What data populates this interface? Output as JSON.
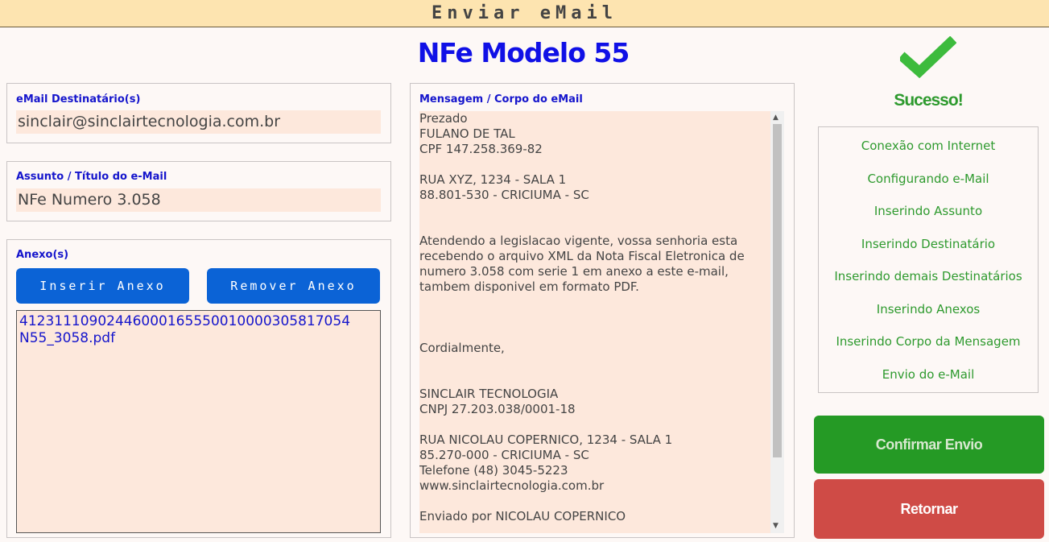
{
  "window": {
    "title": "Enviar eMail"
  },
  "heading": "NFe Modelo 55",
  "recipients": {
    "label": "eMail Destinatário(s)",
    "value": "sinclair@sinclairtecnologia.com.br"
  },
  "subject": {
    "label": "Assunto / Título do e-Mail",
    "value": "NFe Numero 3.058"
  },
  "attachments": {
    "label": "Anexo(s)",
    "insert_label": "Inserir Anexo",
    "remove_label": "Remover Anexo",
    "items": [
      "41231110902446000165550010000305817054",
      "N55_3058.pdf"
    ]
  },
  "message": {
    "label": "Mensagem / Corpo do eMail",
    "body": "Prezado\nFULANO DE TAL\nCPF 147.258.369-82\n\nRUA XYZ, 1234 - SALA 1\n88.801-530 - CRICIUMA - SC\n\n\nAtendendo a legislacao vigente, vossa senhoria esta recebendo o arquivo XML da Nota Fiscal Eletronica de numero 3.058 com serie 1 em anexo a este e-mail, tambem disponivel em formato PDF.\n\n\n\nCordialmente,\n\n\nSINCLAIR TECNOLOGIA\nCNPJ 27.203.038/0001-18\n\nRUA NICOLAU COPERNICO, 1234 - SALA 1\n85.270-000 - CRICIUMA - SC\nTelefone (48) 3045-5223\nwww.sinclairtecnologia.com.br\n\nEnviado por NICOLAU COPERNICO"
  },
  "status": {
    "icon": "checkmark-icon",
    "text": "Sucesso!",
    "color": "#2e9a2e"
  },
  "steps": [
    "Conexão com Internet",
    "Configurando e-Mail",
    "Inserindo Assunto",
    "Inserindo Destinatário",
    "Inserindo demais Destinatários",
    "Inserindo Anexos",
    "Inserindo Corpo da Mensagem",
    "Envio do e-Mail"
  ],
  "actions": {
    "confirm_label": "Confirmar Envio",
    "return_label": "Retornar"
  },
  "colors": {
    "accent_blue": "#0b63d6",
    "confirm_green": "#259a25",
    "return_red": "#cf4b46",
    "title_bar": "#fde4b0"
  }
}
